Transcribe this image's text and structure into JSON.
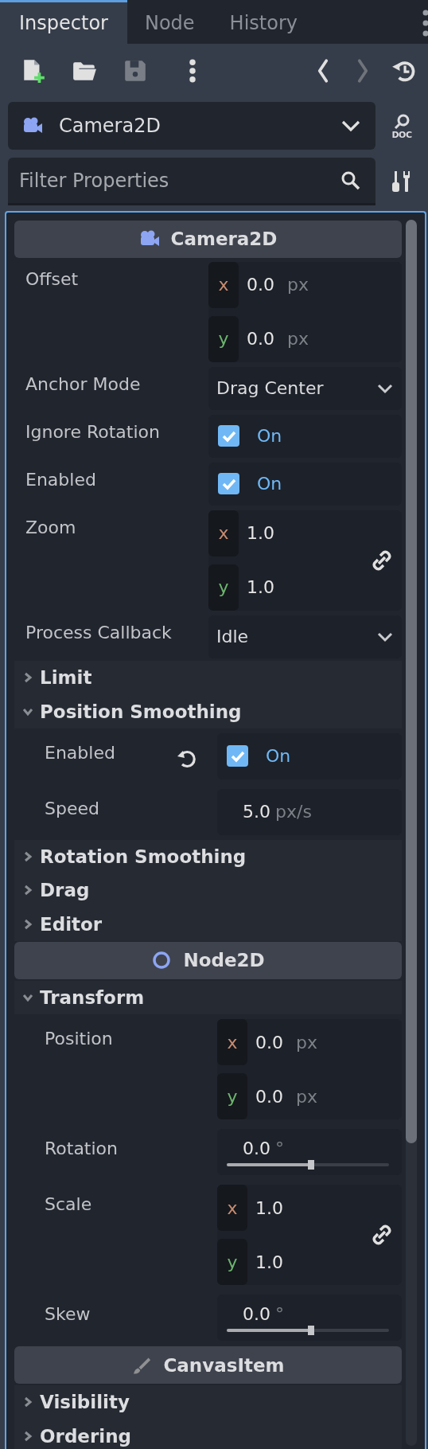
{
  "tabs": [
    {
      "label": "Inspector",
      "selected": true
    },
    {
      "label": "Node",
      "selected": false
    },
    {
      "label": "History",
      "selected": false
    }
  ],
  "toolbar": {
    "save_disabled": true,
    "forward_disabled": true
  },
  "class_select": {
    "value": "Camera2D"
  },
  "doc_button": {
    "label": "DOC"
  },
  "filter": {
    "placeholder": "Filter Properties"
  },
  "sections": [
    {
      "kind": "category",
      "title": "Camera2D"
    },
    {
      "kind": "vector",
      "label": "Offset",
      "components": [
        {
          "axis": "x",
          "value": "0.0",
          "unit": "px"
        },
        {
          "axis": "y",
          "value": "0.0",
          "unit": "px"
        }
      ],
      "linked": false
    },
    {
      "kind": "enum",
      "label": "Anchor Mode",
      "value": "Drag Center"
    },
    {
      "kind": "check",
      "label": "Ignore Rotation",
      "checked": true,
      "value": "On",
      "revertable": false
    },
    {
      "kind": "check",
      "label": "Enabled",
      "checked": true,
      "value": "On",
      "revertable": false
    },
    {
      "kind": "vector",
      "label": "Zoom",
      "components": [
        {
          "axis": "x",
          "value": "1.0"
        },
        {
          "axis": "y",
          "value": "1.0"
        }
      ],
      "linked": true
    },
    {
      "kind": "enum",
      "label": "Process Callback",
      "value": "Idle"
    },
    {
      "kind": "group",
      "title": "Limit",
      "expanded": false
    },
    {
      "kind": "group",
      "title": "Position Smoothing",
      "expanded": true,
      "children": [
        {
          "kind": "check",
          "label": "Enabled",
          "checked": true,
          "value": "On",
          "revertable": true
        },
        {
          "kind": "number",
          "label": "Speed",
          "value": "5.0",
          "unit": "px/s"
        }
      ]
    },
    {
      "kind": "group",
      "title": "Rotation Smoothing",
      "expanded": false
    },
    {
      "kind": "group",
      "title": "Drag",
      "expanded": false
    },
    {
      "kind": "group",
      "title": "Editor",
      "expanded": false
    },
    {
      "kind": "category",
      "title": "Node2D"
    },
    {
      "kind": "group",
      "title": "Transform",
      "expanded": true,
      "children": [
        {
          "kind": "vector",
          "label": "Position",
          "components": [
            {
              "axis": "x",
              "value": "0.0",
              "unit": "px"
            },
            {
              "axis": "y",
              "value": "0.0",
              "unit": "px"
            }
          ],
          "linked": false
        },
        {
          "kind": "slider",
          "label": "Rotation",
          "value": "0.0",
          "unit": "°",
          "level": 0.52
        },
        {
          "kind": "vector",
          "label": "Scale",
          "components": [
            {
              "axis": "x",
              "value": "1.0"
            },
            {
              "axis": "y",
              "value": "1.0"
            }
          ],
          "linked": true
        },
        {
          "kind": "slider",
          "label": "Skew",
          "value": "0.0",
          "unit": "°",
          "level": 0.52
        }
      ]
    },
    {
      "kind": "category",
      "title": "CanvasItem"
    },
    {
      "kind": "group",
      "title": "Visibility",
      "expanded": false
    },
    {
      "kind": "group",
      "title": "Ordering",
      "expanded": false
    }
  ]
}
